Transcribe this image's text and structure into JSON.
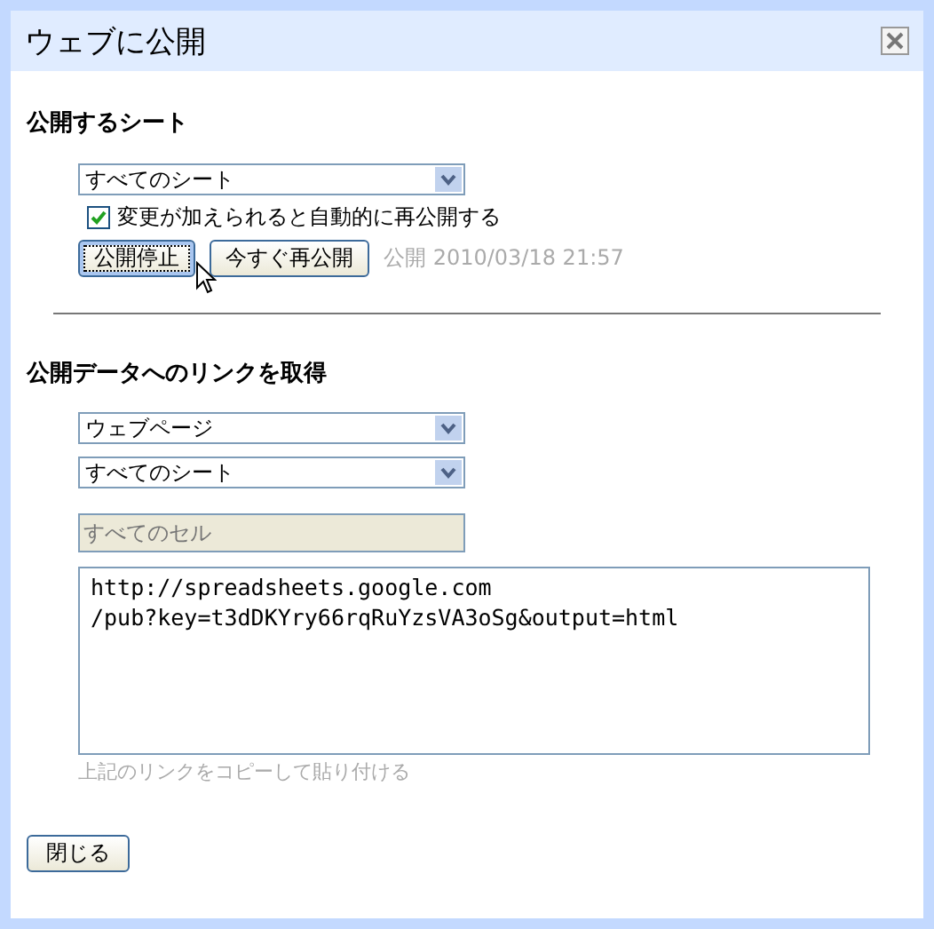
{
  "window": {
    "title": "ウェブに公開"
  },
  "publish_section": {
    "title": "公開するシート",
    "sheet_select": {
      "value": "すべてのシート"
    },
    "auto_republish": {
      "label": "変更が加えられると自動的に再公開する",
      "checked": true
    },
    "buttons": [
      {
        "label": "公開停止",
        "focused": true
      },
      {
        "label": "今すぐ再公開",
        "focused": false
      }
    ],
    "status": {
      "label": "公開",
      "time": "2010/03/18 21:57"
    }
  },
  "link_section": {
    "title": "公開データへのリンクを取得",
    "format_select": {
      "value": "ウェブページ"
    },
    "sheet_select": {
      "value": "すべてのシート"
    },
    "range_field": {
      "placeholder": "すべてのセル",
      "disabled": true
    },
    "link_lines": [
      "http://spreadsheets.google.com",
      "/pub?key=t3dDKYry66rqRuYzsVA3oSg&output=html"
    ],
    "hint": "上記のリンクをコピーして貼り付ける"
  },
  "close_button": {
    "label": "閉じる"
  }
}
